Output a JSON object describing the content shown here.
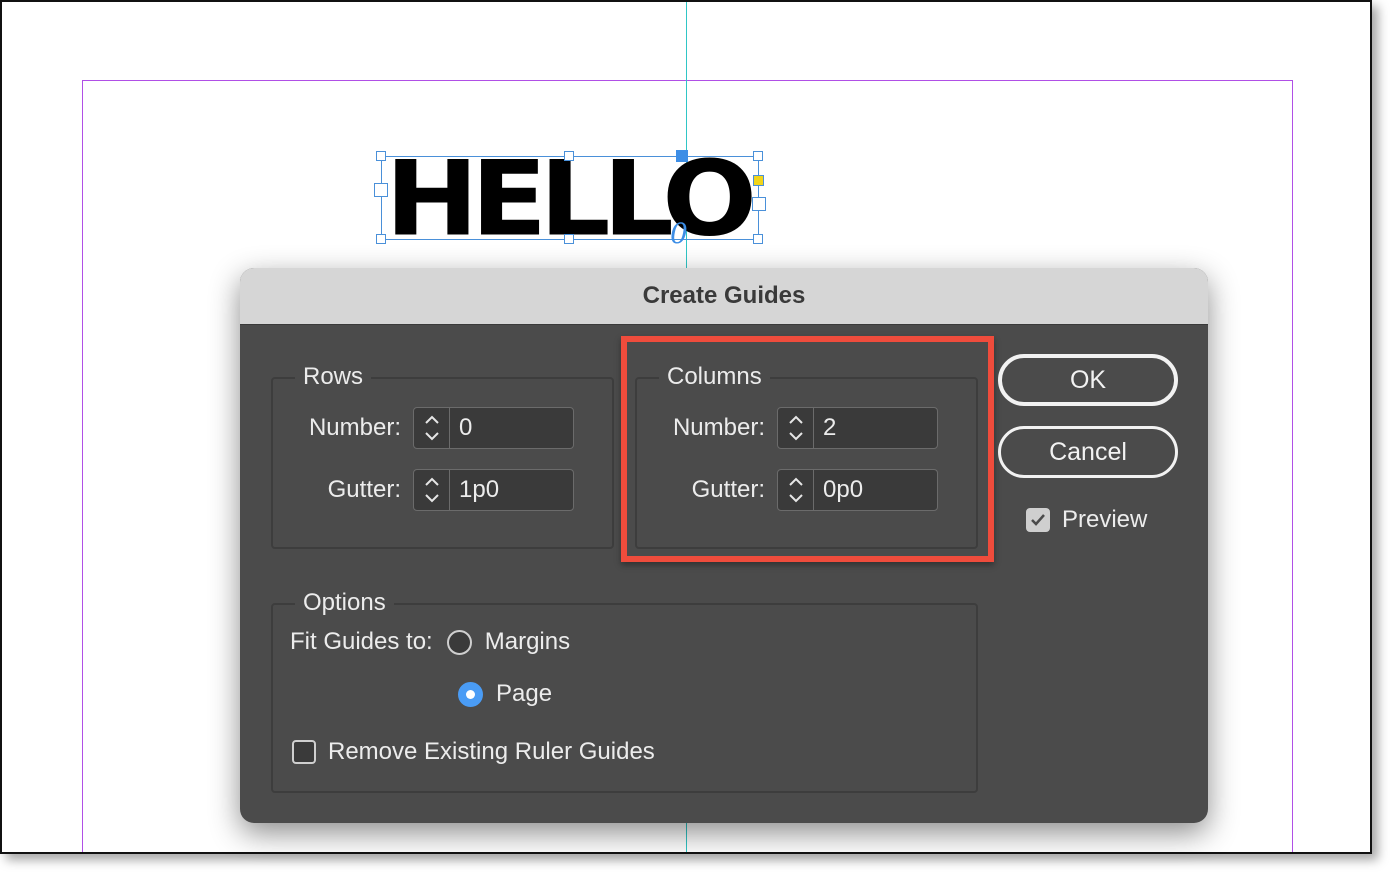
{
  "canvas": {
    "sample_text": "HELLO",
    "overset_glyph": "0",
    "colors": {
      "margin_guide": "#b04fe6",
      "column_guide": "#2fc6c6",
      "frame_selection": "#4a90d9"
    }
  },
  "dialog": {
    "title": "Create Guides",
    "rows": {
      "label": "Rows",
      "number_label": "Number:",
      "number_value": "0",
      "gutter_label": "Gutter:",
      "gutter_value": "1p0"
    },
    "columns": {
      "label": "Columns",
      "number_label": "Number:",
      "number_value": "2",
      "gutter_label": "Gutter:",
      "gutter_value": "0p0",
      "highlight_color": "#ef4c3c"
    },
    "options": {
      "label": "Options",
      "fit_label": "Fit Guides to:",
      "fit_choices": [
        {
          "label": "Margins",
          "selected": false
        },
        {
          "label": "Page",
          "selected": true
        }
      ],
      "remove_existing_label": "Remove Existing Ruler Guides",
      "remove_existing_checked": false
    },
    "buttons": {
      "ok": "OK",
      "cancel": "Cancel"
    },
    "preview": {
      "label": "Preview",
      "checked": true
    },
    "icons": {
      "spinner": "up-down-chevron-icon",
      "check": "checkmark-icon"
    }
  }
}
